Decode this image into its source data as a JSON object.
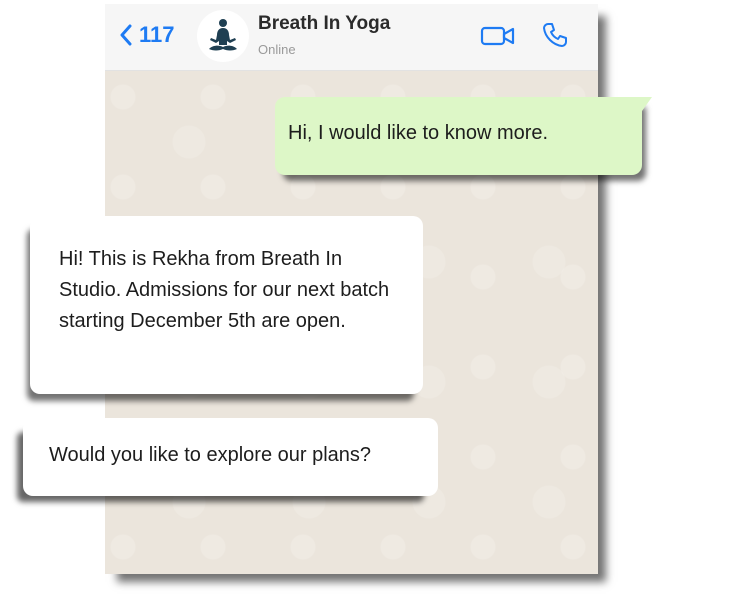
{
  "header": {
    "back_count": "117",
    "contact_name": "Breath In Yoga",
    "contact_status": "Online",
    "icons": {
      "back": "chevron-left-icon",
      "avatar": "yoga-meditation-icon",
      "video": "video-camera-icon",
      "phone": "phone-icon"
    },
    "accent_color": "#1e7bf3"
  },
  "messages": [
    {
      "direction": "outgoing",
      "text": "Hi, I would like to know more."
    },
    {
      "direction": "incoming",
      "text": "Hi! This is Rekha from Breath In Studio. Admissions for our next batch starting December 5th are open."
    },
    {
      "direction": "incoming",
      "text": "Would you like to explore our plans?"
    }
  ],
  "colors": {
    "outgoing_bubble": "#ddf7c7",
    "incoming_bubble": "#ffffff",
    "chat_background": "#ebe5dc"
  }
}
